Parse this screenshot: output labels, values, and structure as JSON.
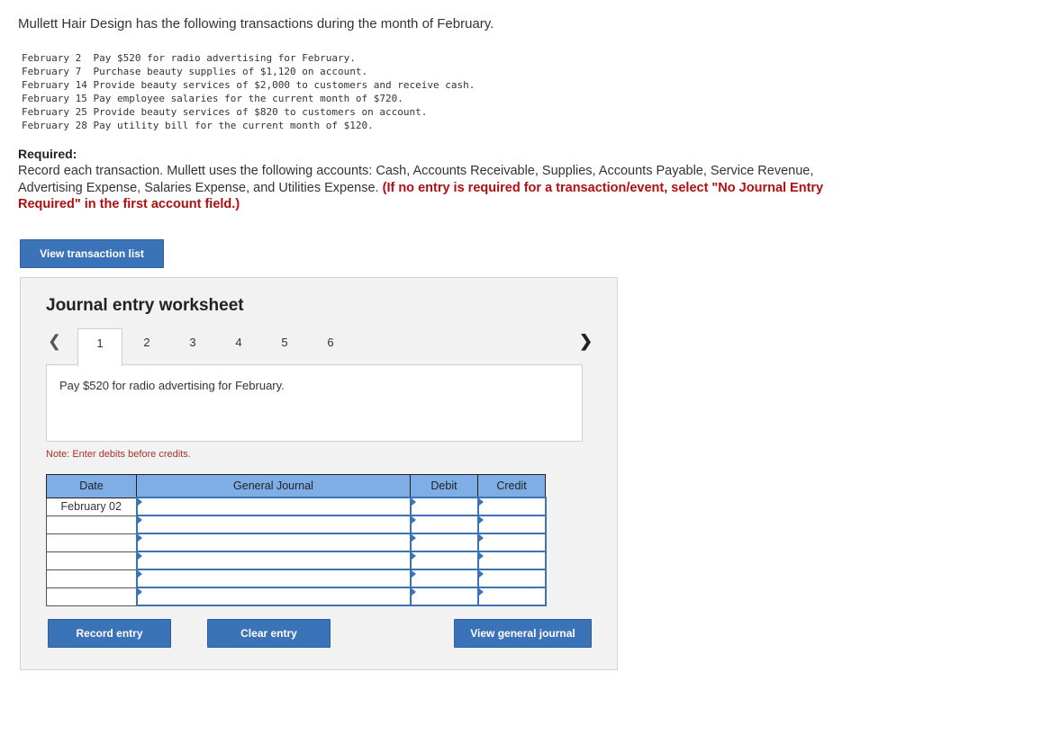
{
  "intro": "Mullett Hair Design has the following transactions during the month of February.",
  "transactions": [
    "February 2  Pay $520 for radio advertising for February.",
    "February 7  Purchase beauty supplies of $1,120 on account.",
    "February 14 Provide beauty services of $2,000 to customers and receive cash.",
    "February 15 Pay employee salaries for the current month of $720.",
    "February 25 Provide beauty services of $820 to customers on account.",
    "February 28 Pay utility bill for the current month of $120."
  ],
  "required": {
    "heading": "Required:",
    "body": "Record each transaction. Mullett uses the following accounts: Cash, Accounts Receivable, Supplies, Accounts Payable, Service Revenue, Advertising Expense, Salaries Expense, and Utilities Expense. ",
    "emphasis": "(If no entry is required for a transaction/event, select \"No Journal Entry Required\" in the first account field.)"
  },
  "view_transaction_list_label": "View transaction list",
  "worksheet": {
    "title": "Journal entry worksheet",
    "prev_icon": "chevron-left-icon",
    "next_icon": "chevron-right-icon",
    "tabs": [
      "1",
      "2",
      "3",
      "4",
      "5",
      "6"
    ],
    "active_tab": "1",
    "description": "Pay $520 for radio advertising for February.",
    "note": "Note: Enter debits before credits.",
    "columns": {
      "date": "Date",
      "account": "General Journal",
      "debit": "Debit",
      "credit": "Credit"
    },
    "rows": [
      {
        "date": "February 02",
        "account": "",
        "debit": "",
        "credit": ""
      },
      {
        "date": "",
        "account": "",
        "debit": "",
        "credit": ""
      },
      {
        "date": "",
        "account": "",
        "debit": "",
        "credit": ""
      },
      {
        "date": "",
        "account": "",
        "debit": "",
        "credit": ""
      },
      {
        "date": "",
        "account": "",
        "debit": "",
        "credit": ""
      },
      {
        "date": "",
        "account": "",
        "debit": "",
        "credit": ""
      }
    ],
    "record_label": "Record entry",
    "clear_label": "Clear entry",
    "view_journal_label": "View general journal"
  },
  "colors": {
    "button": "#3b73b9",
    "header": "#7eaee5",
    "emphasis": "#b00f0f"
  }
}
